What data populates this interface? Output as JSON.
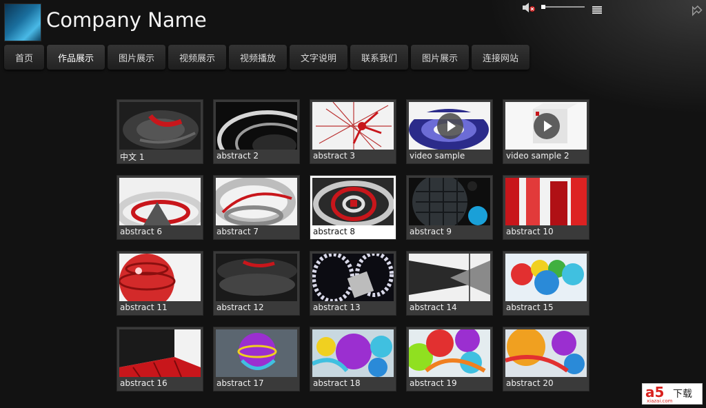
{
  "header": {
    "company_name": "Company Name"
  },
  "player_controls": {
    "mute_icon": "speaker-muted-icon",
    "volume_icon": "volume-slider",
    "menu_icon": "list-menu-icon"
  },
  "corner_icon": "fullscreen-arrow-icon",
  "nav": {
    "items": [
      {
        "label": "首页"
      },
      {
        "label": "作品展示"
      },
      {
        "label": "图片展示"
      },
      {
        "label": "视频展示"
      },
      {
        "label": "视频播放"
      },
      {
        "label": "文字说明"
      },
      {
        "label": "联系我们"
      },
      {
        "label": "图片展示"
      },
      {
        "label": "连接网站"
      }
    ],
    "active_index": 1
  },
  "gallery": {
    "items": [
      {
        "label": "中文 1"
      },
      {
        "label": "abstract 2"
      },
      {
        "label": "abstract 3"
      },
      {
        "label": "video sample"
      },
      {
        "label": "video sample 2"
      },
      {
        "label": "abstract 6"
      },
      {
        "label": "abstract 7"
      },
      {
        "label": "abstract 8"
      },
      {
        "label": "abstract 9"
      },
      {
        "label": "abstract 10"
      },
      {
        "label": "abstract 11"
      },
      {
        "label": "abstract 12"
      },
      {
        "label": "abstract 13"
      },
      {
        "label": "abstract 14"
      },
      {
        "label": "abstract 15"
      },
      {
        "label": "abstract 16"
      },
      {
        "label": "abstract 17"
      },
      {
        "label": "abstract 18"
      },
      {
        "label": "abstract 19"
      },
      {
        "label": "abstract 20"
      }
    ],
    "selected_index": 7,
    "video_indices": [
      3,
      4
    ]
  },
  "watermark": {
    "brand": "a5",
    "text": "下载",
    "url": "xiazai.com"
  },
  "colors": {
    "background": "#121212",
    "tile": "#3a3a3a",
    "tile_selected": "#ffffff",
    "accent_red": "#d9211e"
  }
}
